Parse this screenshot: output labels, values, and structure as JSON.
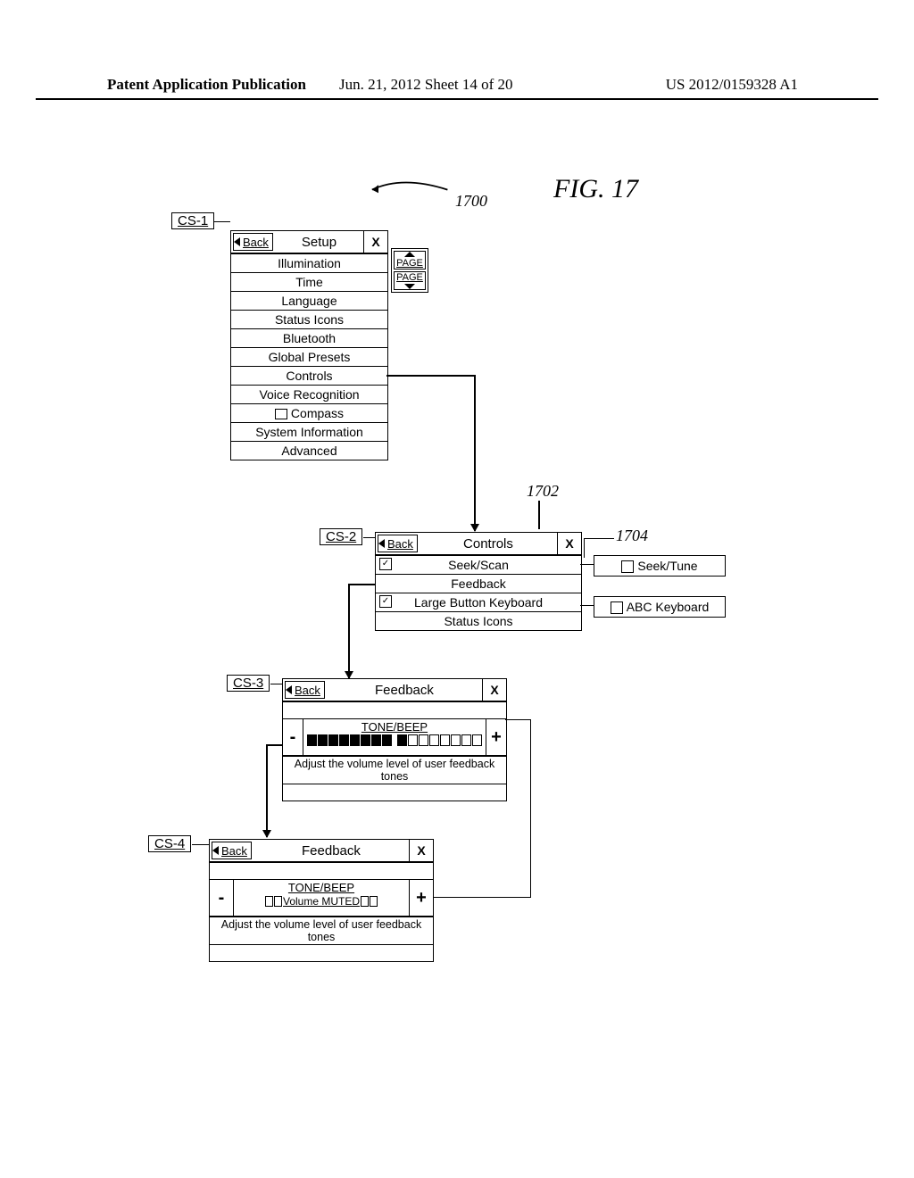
{
  "header": {
    "left": "Patent Application Publication",
    "mid": "Jun. 21, 2012  Sheet 14 of 20",
    "right": "US 2012/0159328 A1"
  },
  "figure_label": "FIG. 17",
  "refs": {
    "r1700": "1700",
    "r1702": "1702",
    "r1704": "1704"
  },
  "labels": {
    "cs1": "CS-1",
    "cs2": "CS-2",
    "cs3": "CS-3",
    "cs4": "CS-4"
  },
  "common": {
    "back": "Back",
    "close": "X",
    "page": "PAGE"
  },
  "cs1": {
    "title": "Setup",
    "items": [
      "Illumination",
      "Time",
      "Language",
      "Status Icons",
      "Bluetooth",
      "Global Presets",
      "Controls",
      "Voice Recognition",
      "Compass",
      "System Information",
      "Advanced"
    ]
  },
  "cs2": {
    "title": "Controls",
    "rows": [
      {
        "label": "Seek/Scan",
        "check": true
      },
      {
        "label": "Feedback",
        "check": false
      },
      {
        "label": "Large Button Keyboard",
        "check": true
      },
      {
        "label": "Status Icons",
        "check": false
      }
    ],
    "side": [
      {
        "label": "Seek/Tune"
      },
      {
        "label": "ABC Keyboard"
      }
    ]
  },
  "cs3": {
    "title": "Feedback",
    "tone_label": "TONE/BEEP",
    "minus": "-",
    "plus": "+",
    "filled_segments": 8,
    "total_segments": 16,
    "help": "Adjust the volume level of user feedback tones"
  },
  "cs4": {
    "title": "Feedback",
    "tone_label": "TONE/BEEP",
    "muted_label": "Volume MUTED",
    "minus": "-",
    "plus": "+",
    "help": "Adjust the volume level of user feedback tones"
  }
}
